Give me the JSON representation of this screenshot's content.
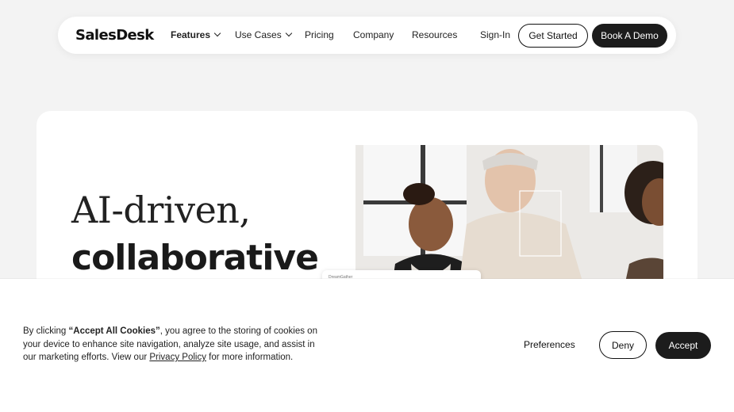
{
  "nav": {
    "logo": "SalesDesk",
    "features": "Features",
    "use_cases": "Use Cases",
    "pricing": "Pricing",
    "company": "Company",
    "resources": "Resources",
    "sign_in": "Sign-In",
    "get_started": "Get Started",
    "book_demo": "Book A Demo"
  },
  "hero": {
    "line1": "AI-driven,",
    "line2": "collaborative",
    "mini_card_text": "DreamGather"
  },
  "cookie": {
    "text_before": "By clicking ",
    "text_bold": "“Accept All Cookies”",
    "text_mid": ", you agree to the storing of cookies on your device to enhance site navigation, analyze site usage, and assist in our marketing efforts. View our ",
    "link": "Privacy Policy",
    "text_after": " for more information.",
    "preferences": "Preferences",
    "deny": "Deny",
    "accept": "Accept"
  },
  "colors": {
    "page_bg": "#f3f3f3",
    "dark_button": "#1c1c1c",
    "card_bg": "#ffffff"
  }
}
